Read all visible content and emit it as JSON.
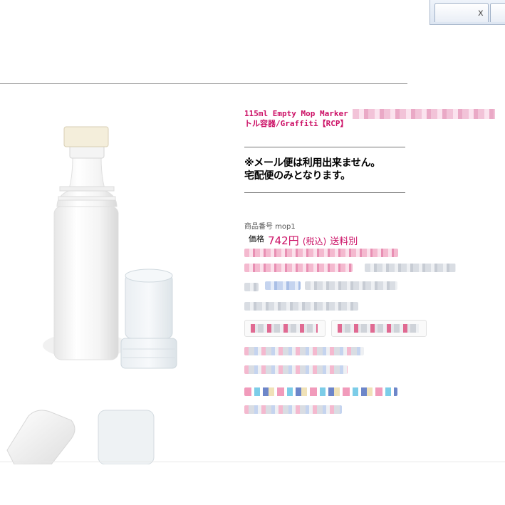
{
  "window": {
    "tab_close_glyph": "x"
  },
  "product": {
    "title_visible_start": "115ml Empty Mop Marker",
    "title_visible_end": "トル容器/Graffiti【RCP】",
    "notice_line1": "※メール便は利用出来ません。",
    "notice_line2": "宅配便のみとなります。",
    "code_label": "商品番号",
    "code_value": "mop1",
    "price_label": "価格",
    "price_value": "742円",
    "price_tax": "(税込)",
    "shipping": "送料別"
  },
  "colors": {
    "accent": "#cc1166",
    "divider": "#777777"
  }
}
